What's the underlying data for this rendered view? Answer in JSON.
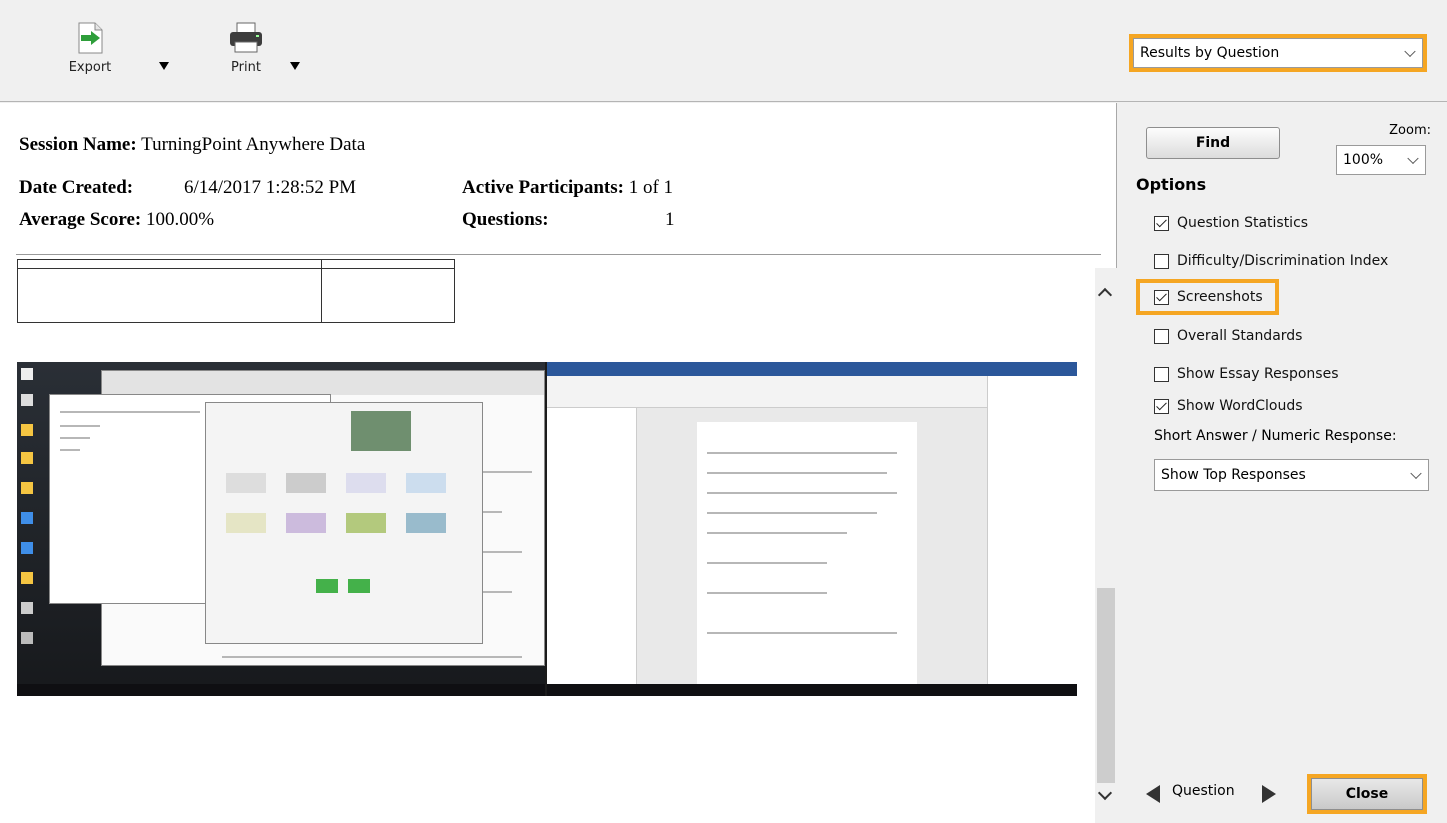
{
  "toolbar": {
    "export_label": "Export",
    "print_label": "Print",
    "report_type": "Results by Question"
  },
  "report": {
    "session_label": "Session Name:",
    "session_value": "TurningPoint Anywhere Data",
    "date_label": "Date Created:",
    "date_value": "6/14/2017 1:28:52 PM",
    "avg_label": "Average Score:",
    "avg_value": "100.00%",
    "participants_label": "Active Participants:",
    "participants_value": "1 of 1",
    "questions_label": "Questions:",
    "questions_value": "1"
  },
  "panel": {
    "find_label": "Find",
    "zoom_label": "Zoom:",
    "zoom_value": "100%",
    "options_title": "Options",
    "options": [
      {
        "label": "Question Statistics",
        "checked": true
      },
      {
        "label": "Difficulty/Discrimination Index",
        "checked": false
      },
      {
        "label": "Screenshots",
        "checked": true
      },
      {
        "label": "Overall Standards",
        "checked": false
      },
      {
        "label": "Show Essay Responses",
        "checked": false
      },
      {
        "label": "Show WordClouds",
        "checked": true
      }
    ],
    "short_answer_label": "Short Answer / Numeric Response:",
    "short_answer_value": "Show Top Responses",
    "question_nav_label": "Question",
    "close_label": "Close"
  },
  "colors": {
    "highlight": "#f5a623",
    "word_blue": "#2b579a"
  },
  "icons": [
    "export-icon",
    "printer-icon",
    "dropdown-arrow-icon",
    "chevron-down-icon",
    "scroll-up-icon",
    "scroll-down-icon",
    "previous-arrow-icon",
    "next-arrow-icon"
  ]
}
